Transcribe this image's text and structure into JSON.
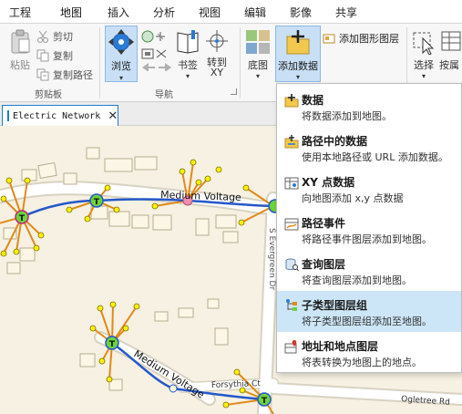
{
  "ribbon_tabs": [
    {
      "label": "工程"
    },
    {
      "label": "地图",
      "active": true
    },
    {
      "label": "插入"
    },
    {
      "label": "分析"
    },
    {
      "label": "视图"
    },
    {
      "label": "编辑"
    },
    {
      "label": "影像"
    },
    {
      "label": "共享"
    }
  ],
  "clipboard": {
    "paste_label": "粘贴",
    "cut_label": "剪切",
    "copy_label": "复制",
    "copy_path_label": "复制路径",
    "group_label": "剪贴板"
  },
  "navigate": {
    "browse_label": "浏览",
    "bookmarks_label": "书签",
    "goto_label": "转到\nXY",
    "group_label": "导航"
  },
  "layer": {
    "basemap_label": "底图",
    "add_data_label": "添加数据",
    "add_graphics_label": "添加图形图层"
  },
  "selection": {
    "select_label": "选择",
    "attributes_label": "按属"
  },
  "document_tab": {
    "title": "Electric Network",
    "close_glyph": "✕"
  },
  "map": {
    "labels": {
      "medium_voltage_1": "Medium Voltage",
      "medium_voltage_2": "Medium Voltage",
      "evergreen": "S Evergreen Dr",
      "forsythia": "Forsythia Ct",
      "ogletree": "Ogletree Rd",
      "transformer_symbol": "T"
    },
    "colors": {
      "ground": "#f6f1e2",
      "road": "#ffffff",
      "primary_line": "#2457c9",
      "secondary_line": "#e08a1a",
      "transformer": "#6bd33b",
      "meter": "#fff200"
    }
  },
  "add_data_menu": {
    "items": [
      {
        "title": "数据",
        "desc": "将数据添加到地图。",
        "icon": "add-data-icon",
        "highlighted": false
      },
      {
        "title": "路径中的数据",
        "desc": "使用本地路径或 URL 添加数据。",
        "icon": "data-from-path-icon",
        "highlighted": false
      },
      {
        "title": "XY 点数据",
        "desc": "向地图添加 x,y 点数据",
        "icon": "xy-point-data-icon",
        "highlighted": false
      },
      {
        "title": "路径事件",
        "desc": "将路径事件图层添加到地图。",
        "icon": "route-events-icon",
        "highlighted": false
      },
      {
        "title": "查询图层",
        "desc": "将查询图层添加到地图。",
        "icon": "query-layer-icon",
        "highlighted": false
      },
      {
        "title": "子类型图层组",
        "desc": "将子类型图层组添加至地图。",
        "icon": "subtype-group-layer-icon",
        "highlighted": true
      },
      {
        "title": "地址和地点图层",
        "desc": "将表转换为地图上的地点。",
        "icon": "address-locations-icon",
        "highlighted": false
      }
    ]
  }
}
